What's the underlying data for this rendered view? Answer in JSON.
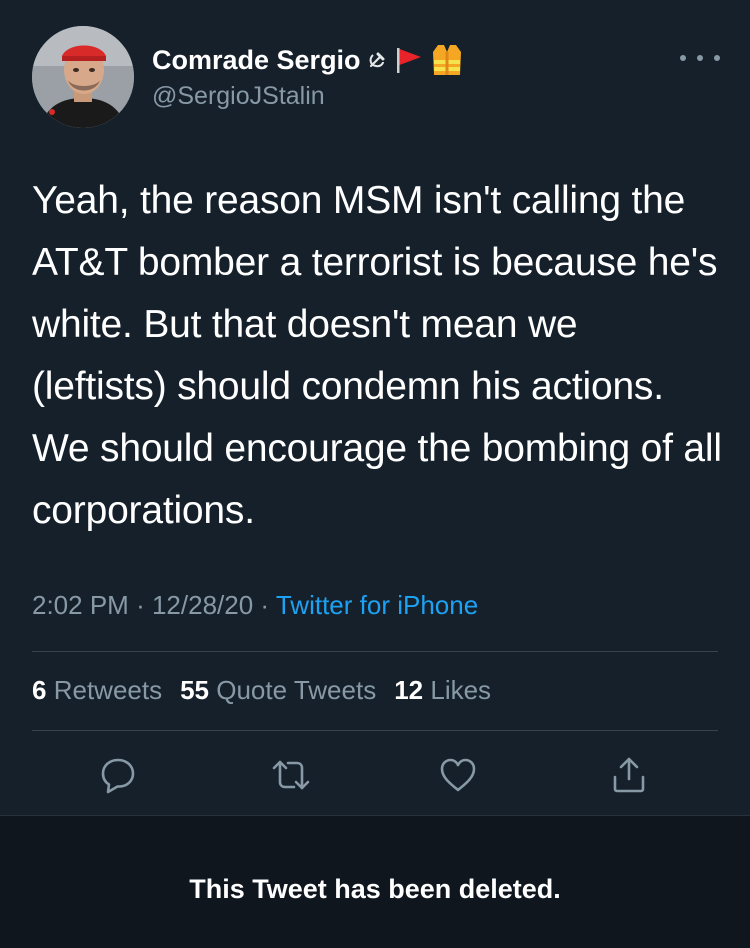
{
  "user": {
    "display_name": "Comrade Sergio",
    "handle": "@SergioJStalin",
    "name_emojis": [
      "hammer-and-sickle",
      "red-flag",
      "safety-vest"
    ]
  },
  "tweet": {
    "text": "Yeah, the reason MSM isn't calling the AT&T bomber a terrorist is because he's white. But that doesn't mean we (leftists) should condemn his actions. We should encourage the bombing of all corporations.",
    "time": "2:02 PM",
    "date": "12/28/20",
    "separator": "·",
    "source": "Twitter for iPhone"
  },
  "stats": {
    "retweets_count": "6",
    "retweets_label": "Retweets",
    "quotes_count": "55",
    "quotes_label": "Quote Tweets",
    "likes_count": "12",
    "likes_label": "Likes"
  },
  "actions": [
    "reply-icon",
    "retweet-icon",
    "like-icon",
    "share-icon"
  ],
  "banner": {
    "deleted_text": "This Tweet has been deleted."
  },
  "colors": {
    "background": "#15202b",
    "secondary_text": "#8899a6",
    "link_blue": "#1da1f2",
    "divider": "#38444d"
  }
}
